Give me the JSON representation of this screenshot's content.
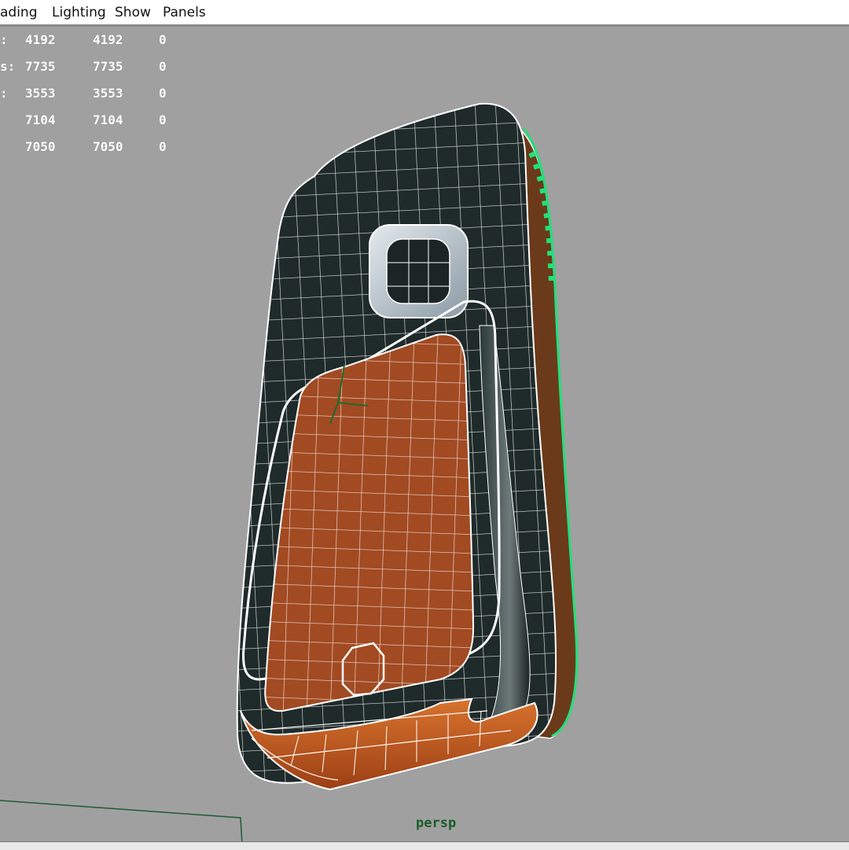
{
  "menu": {
    "items": [
      {
        "label": "ading"
      },
      {
        "label": "Lighting"
      },
      {
        "label": "Show"
      },
      {
        "label": "Panels"
      }
    ]
  },
  "hud": {
    "labels": [
      ":",
      "s:",
      ":"
    ],
    "col1": [
      "4192",
      "7735",
      "3553",
      "7104",
      "7050"
    ],
    "col2": [
      "4192",
      "7735",
      "3553",
      "7104",
      "7050"
    ],
    "col3": [
      "0",
      "0",
      "0",
      "0",
      "0"
    ]
  },
  "viewport": {
    "camera_label": "persp",
    "background_color": "#a0a0a0",
    "wireframe_color": "#ffffff",
    "body_color": "#1f2a2a",
    "cover_color": "#a24a22",
    "selection_color": "#21e07a"
  }
}
